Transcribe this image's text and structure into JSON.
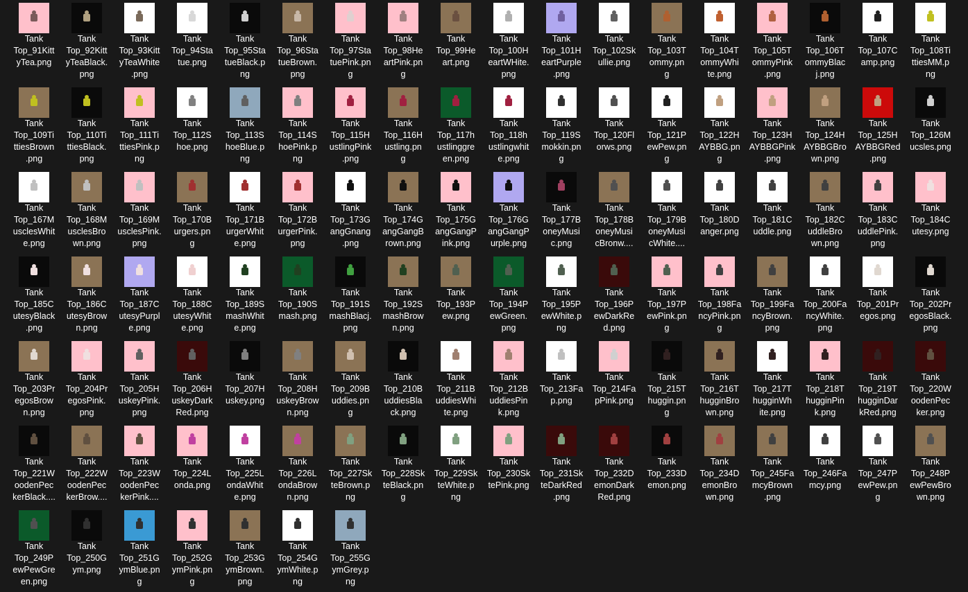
{
  "files": [
    {
      "name": "Tank\nTop_91Kitt\nyTea.png",
      "bg": "#ffc0cb",
      "fg": "#7a5a5a"
    },
    {
      "name": "Tank\nTop_92Kitt\nyTeaBlack.\npng",
      "bg": "#0a0a0a",
      "fg": "#b0a080"
    },
    {
      "name": "Tank\nTop_93Kitt\nyTeaWhite\n.png",
      "bg": "#ffffff",
      "fg": "#7a6a5a"
    },
    {
      "name": "Tank\nTop_94Sta\ntue.png",
      "bg": "#ffffff",
      "fg": "#d8d8d8"
    },
    {
      "name": "Tank\nTop_95Sta\ntueBlack.p\nng",
      "bg": "#0a0a0a",
      "fg": "#d0d0d0"
    },
    {
      "name": "Tank\nTop_96Sta\ntueBrown.\npng",
      "bg": "#8b7355",
      "fg": "#c8b8a8"
    },
    {
      "name": "Tank\nTop_97Sta\ntuePink.pn\ng",
      "bg": "#ffc0cb",
      "fg": "#e0d0d0"
    },
    {
      "name": "Tank\nTop_98He\nartPink.pn\ng",
      "bg": "#ffc0cb",
      "fg": "#a08080"
    },
    {
      "name": "Tank\nTop_99He\nart.png",
      "bg": "#8b7355",
      "fg": "#6a5040"
    },
    {
      "name": "Tank\nTop_100H\neartWHite.\npng",
      "bg": "#ffffff",
      "fg": "#b0b0b0"
    },
    {
      "name": "Tank\nTop_101H\neartPurple\n.png",
      "bg": "#b0a8f0",
      "fg": "#7060a0"
    },
    {
      "name": "Tank\nTop_102Sk\nullie.png",
      "bg": "#ffffff",
      "fg": "#606060"
    },
    {
      "name": "Tank\nTop_103T\nommy.pn\ng",
      "bg": "#8b7355",
      "fg": "#b06030"
    },
    {
      "name": "Tank\nTop_104T\nommyWhi\nte.png",
      "bg": "#ffffff",
      "fg": "#c06030"
    },
    {
      "name": "Tank\nTop_105T\nommyPink\n.png",
      "bg": "#ffc0cb",
      "fg": "#b06040"
    },
    {
      "name": "Tank\nTop_106T\nommyBlac\nj.png",
      "bg": "#0a0a0a",
      "fg": "#b06030"
    },
    {
      "name": "Tank\nTop_107C\namp.png",
      "bg": "#ffffff",
      "fg": "#202020"
    },
    {
      "name": "Tank\nTop_108Ti\nttiesMM.p\nng",
      "bg": "#ffffff",
      "fg": "#c0c020"
    },
    {
      "name": "Tank\nTop_109Ti\nttiesBrown\n.png",
      "bg": "#8b7355",
      "fg": "#c0c020"
    },
    {
      "name": "Tank\nTop_110Ti\nttiesBlack.\npng",
      "bg": "#0a0a0a",
      "fg": "#c0c020"
    },
    {
      "name": "Tank\nTop_111Ti\nttiesPink.p\nng",
      "bg": "#ffc0cb",
      "fg": "#c0c020"
    },
    {
      "name": "Tank\nTop_112S\nhoe.png",
      "bg": "#ffffff",
      "fg": "#808080"
    },
    {
      "name": "Tank\nTop_113S\nhoeBlue.p\nng",
      "bg": "#8fa8bc",
      "fg": "#606060"
    },
    {
      "name": "Tank\nTop_114S\nhoePink.p\nng",
      "bg": "#ffc0cb",
      "fg": "#808080"
    },
    {
      "name": "Tank\nTop_115H\nustlingPink\n.png",
      "bg": "#ffc0cb",
      "fg": "#a02040"
    },
    {
      "name": "Tank\nTop_116H\nustling.pn\ng",
      "bg": "#8b7355",
      "fg": "#a02040"
    },
    {
      "name": "Tank\nTop_117h\nustlinggre\nen.png",
      "bg": "#0b5a2a",
      "fg": "#a02040"
    },
    {
      "name": "Tank\nTop_118h\nustlingwhit\ne.png",
      "bg": "#ffffff",
      "fg": "#a02040"
    },
    {
      "name": "Tank\nTop_119S\nmokkin.pn\ng",
      "bg": "#ffffff",
      "fg": "#303030"
    },
    {
      "name": "Tank\nTop_120Fl\norws.png",
      "bg": "#ffffff",
      "fg": "#505050"
    },
    {
      "name": "Tank\nTop_121P\newPew.pn\ng",
      "bg": "#ffffff",
      "fg": "#202020"
    },
    {
      "name": "Tank\nTop_122H\nAYBBG.pn\ng",
      "bg": "#ffffff",
      "fg": "#c0a080"
    },
    {
      "name": "Tank\nTop_123H\nAYBBGPink\n.png",
      "bg": "#ffc0cb",
      "fg": "#c0a080"
    },
    {
      "name": "Tank\nTop_124H\nAYBBGBro\nwn.png",
      "bg": "#8b7355",
      "fg": "#c0a080"
    },
    {
      "name": "Tank\nTop_125H\nAYBBGRed\n.png",
      "bg": "#cc0a0a",
      "fg": "#c0a080"
    },
    {
      "name": "Tank\nTop_126M\nucsles.png",
      "bg": "#0a0a0a",
      "fg": "#d0d0d0"
    },
    {
      "name": "Tank\nTop_167M\nusclesWhit\ne.png",
      "bg": "#ffffff",
      "fg": "#c0c0c0"
    },
    {
      "name": "Tank\nTop_168M\nusclesBro\nwn.png",
      "bg": "#8b7355",
      "fg": "#c0c0c0"
    },
    {
      "name": "Tank\nTop_169M\nusclesPink.\npng",
      "bg": "#ffc0cb",
      "fg": "#c0c0c0"
    },
    {
      "name": "Tank\nTop_170B\nurgers.pn\ng",
      "bg": "#8b7355",
      "fg": "#a03030"
    },
    {
      "name": "Tank\nTop_171B\nurgerWhit\ne.png",
      "bg": "#ffffff",
      "fg": "#a03030"
    },
    {
      "name": "Tank\nTop_172B\nurgerPink.\npng",
      "bg": "#ffc0cb",
      "fg": "#a03030"
    },
    {
      "name": "Tank\nTop_173G\nangGnang\n.png",
      "bg": "#ffffff",
      "fg": "#101010"
    },
    {
      "name": "Tank\nTop_174G\nangGangB\nrown.png",
      "bg": "#8b7355",
      "fg": "#101010"
    },
    {
      "name": "Tank\nTop_175G\nangGangP\nink.png",
      "bg": "#ffc0cb",
      "fg": "#101010"
    },
    {
      "name": "Tank\nTop_176G\nangGangP\nurple.png",
      "bg": "#b0a8f0",
      "fg": "#101010"
    },
    {
      "name": "Tank\nTop_177B\noneyMusi\nc.png",
      "bg": "#0a0a0a",
      "fg": "#a04060"
    },
    {
      "name": "Tank\nTop_178B\noneyMusi\ncBronw....",
      "bg": "#8b7355",
      "fg": "#505050"
    },
    {
      "name": "Tank\nTop_179B\noneyMusi\ncWhite....",
      "bg": "#ffffff",
      "fg": "#505050"
    },
    {
      "name": "Tank\nTop_180D\nanger.png",
      "bg": "#ffffff",
      "fg": "#404040"
    },
    {
      "name": "Tank\nTop_181C\nuddle.png",
      "bg": "#ffffff",
      "fg": "#404040"
    },
    {
      "name": "Tank\nTop_182C\nuddleBro\nwn.png",
      "bg": "#8b7355",
      "fg": "#404040"
    },
    {
      "name": "Tank\nTop_183C\nuddlePink.\npng",
      "bg": "#ffc0cb",
      "fg": "#404040"
    },
    {
      "name": "Tank\nTop_184C\nutesy.png",
      "bg": "#ffc0cb",
      "fg": "#f0e0e0"
    },
    {
      "name": "Tank\nTop_185C\nutesyBlack\n.png",
      "bg": "#0a0a0a",
      "fg": "#f0e0e0"
    },
    {
      "name": "Tank\nTop_186C\nutesyBrow\nn.png",
      "bg": "#8b7355",
      "fg": "#f0e0e0"
    },
    {
      "name": "Tank\nTop_187C\nutesyPurpl\ne.png",
      "bg": "#b0a8f0",
      "fg": "#f0e0e0"
    },
    {
      "name": "Tank\nTop_188C\nutesyWhit\ne.png",
      "bg": "#ffffff",
      "fg": "#f0d0d0"
    },
    {
      "name": "Tank\nTop_189S\nmashWhit\ne.png",
      "bg": "#ffffff",
      "fg": "#204020"
    },
    {
      "name": "Tank\nTop_190S\nmash.png",
      "bg": "#0b5a2a",
      "fg": "#204020"
    },
    {
      "name": "Tank\nTop_191S\nmashBlacj.\npng",
      "bg": "#0a0a0a",
      "fg": "#40a040"
    },
    {
      "name": "Tank\nTop_192S\nmashBrow\nn.png",
      "bg": "#8b7355",
      "fg": "#204020"
    },
    {
      "name": "Tank\nTop_193P\new.png",
      "bg": "#8b7355",
      "fg": "#506050"
    },
    {
      "name": "Tank\nTop_194P\newGreen.\npng",
      "bg": "#0b5a2a",
      "fg": "#506050"
    },
    {
      "name": "Tank\nTop_195P\newWhite.p\nng",
      "bg": "#ffffff",
      "fg": "#506050"
    },
    {
      "name": "Tank\nTop_196P\newDarkRe\nd.png",
      "bg": "#3a0a0a",
      "fg": "#506050"
    },
    {
      "name": "Tank\nTop_197P\newPink.pn\ng",
      "bg": "#ffc0cb",
      "fg": "#506050"
    },
    {
      "name": "Tank\nTop_198Fa\nncyPink.pn\ng",
      "bg": "#ffc0cb",
      "fg": "#404040"
    },
    {
      "name": "Tank\nTop_199Fa\nncyBrown.\npng",
      "bg": "#8b7355",
      "fg": "#404040"
    },
    {
      "name": "Tank\nTop_200Fa\nncyWhite.\npng",
      "bg": "#ffffff",
      "fg": "#404040"
    },
    {
      "name": "Tank\nTop_201Pr\negos.png",
      "bg": "#ffffff",
      "fg": "#e0d8d0"
    },
    {
      "name": "Tank\nTop_202Pr\negosBlack.\npng",
      "bg": "#0a0a0a",
      "fg": "#e0d8d0"
    },
    {
      "name": "Tank\nTop_203Pr\negosBrow\nn.png",
      "bg": "#8b7355",
      "fg": "#e0d8d0"
    },
    {
      "name": "Tank\nTop_204Pr\negosPink.\npng",
      "bg": "#ffc0cb",
      "fg": "#f0e0e0"
    },
    {
      "name": "Tank\nTop_205H\nuskeyPink.\npng",
      "bg": "#ffc0cb",
      "fg": "#606060"
    },
    {
      "name": "Tank\nTop_206H\nuskeyDark\nRed.png",
      "bg": "#3a0a0a",
      "fg": "#606060"
    },
    {
      "name": "Tank\nTop_207H\nuskey.png",
      "bg": "#0a0a0a",
      "fg": "#808080"
    },
    {
      "name": "Tank\nTop_208H\nuskeyBrow\nn.png",
      "bg": "#8b7355",
      "fg": "#808080"
    },
    {
      "name": "Tank\nTop_209B\nuddies.pn\ng",
      "bg": "#8b7355",
      "fg": "#d0c0b0"
    },
    {
      "name": "Tank\nTop_210B\nuddiesBla\nck.png",
      "bg": "#0a0a0a",
      "fg": "#d0c0b0"
    },
    {
      "name": "Tank\nTop_211B\nuddiesWhi\nte.png",
      "bg": "#ffffff",
      "fg": "#a08070"
    },
    {
      "name": "Tank\nTop_212B\nuddiesPin\nk.png",
      "bg": "#ffc0cb",
      "fg": "#a08070"
    },
    {
      "name": "Tank\nTop_213Fa\np.png",
      "bg": "#ffffff",
      "fg": "#c0c0c0"
    },
    {
      "name": "Tank\nTop_214Fa\npPink.png",
      "bg": "#ffc0cb",
      "fg": "#d0d0d0"
    },
    {
      "name": "Tank\nTop_215T\nhuggin.pn\ng",
      "bg": "#0a0a0a",
      "fg": "#302020"
    },
    {
      "name": "Tank\nTop_216T\nhugginBro\nwn.png",
      "bg": "#8b7355",
      "fg": "#302020"
    },
    {
      "name": "Tank\nTop_217T\nhugginWh\nite.png",
      "bg": "#ffffff",
      "fg": "#302020"
    },
    {
      "name": "Tank\nTop_218T\nhugginPin\nk.png",
      "bg": "#ffc0cb",
      "fg": "#302020"
    },
    {
      "name": "Tank\nTop_219T\nhugginDar\nkRed.png",
      "bg": "#3a0a0a",
      "fg": "#302020"
    },
    {
      "name": "Tank\nTop_220W\noodenPec\nker.png",
      "bg": "#3a0a0a",
      "fg": "#605040"
    },
    {
      "name": "Tank\nTop_221W\noodenPec\nkerBlack....",
      "bg": "#0a0a0a",
      "fg": "#605040"
    },
    {
      "name": "Tank\nTop_222W\noodenPec\nkerBrow....",
      "bg": "#8b7355",
      "fg": "#605040"
    },
    {
      "name": "Tank\nTop_223W\noodenPec\nkerPink....",
      "bg": "#ffc0cb",
      "fg": "#605040"
    },
    {
      "name": "Tank\nTop_224L\nonda.png",
      "bg": "#ffc0cb",
      "fg": "#c040a0"
    },
    {
      "name": "Tank\nTop_225L\nondaWhit\ne.png",
      "bg": "#ffffff",
      "fg": "#c040a0"
    },
    {
      "name": "Tank\nTop_226L\nondaBrow\nn.png",
      "bg": "#8b7355",
      "fg": "#c040a0"
    },
    {
      "name": "Tank\nTop_227Sk\nteBrown.p\nng",
      "bg": "#8b7355",
      "fg": "#80a080"
    },
    {
      "name": "Tank\nTop_228Sk\nteBlack.pn\ng",
      "bg": "#0a0a0a",
      "fg": "#80a080"
    },
    {
      "name": "Tank\nTop_229Sk\nteWhite.p\nng",
      "bg": "#ffffff",
      "fg": "#80a080"
    },
    {
      "name": "Tank\nTop_230Sk\ntePink.png",
      "bg": "#ffc0cb",
      "fg": "#80a080"
    },
    {
      "name": "Tank\nTop_231Sk\nteDarkRed\n.png",
      "bg": "#3a0a0a",
      "fg": "#80a080"
    },
    {
      "name": "Tank\nTop_232D\nemonDark\nRed.png",
      "bg": "#3a0a0a",
      "fg": "#a04040"
    },
    {
      "name": "Tank\nTop_233D\nemon.png",
      "bg": "#0a0a0a",
      "fg": "#a04040"
    },
    {
      "name": "Tank\nTop_234D\nemonBro\nwn.png",
      "bg": "#8b7355",
      "fg": "#a04040"
    },
    {
      "name": "Tank\nTop_245Fa\nmcyBrown\n.png",
      "bg": "#8b7355",
      "fg": "#404040"
    },
    {
      "name": "Tank\nTop_246Fa\nmcy.png",
      "bg": "#ffffff",
      "fg": "#404040"
    },
    {
      "name": "Tank\nTop_247P\newPew.pn\ng",
      "bg": "#ffffff",
      "fg": "#505050"
    },
    {
      "name": "Tank\nTop_248P\newPewBro\nwn.png",
      "bg": "#8b7355",
      "fg": "#505050"
    },
    {
      "name": "Tank\nTop_249P\newPewGre\nen.png",
      "bg": "#0b5a2a",
      "fg": "#505050"
    },
    {
      "name": "Tank\nTop_250G\nym.png",
      "bg": "#0a0a0a",
      "fg": "#303030"
    },
    {
      "name": "Tank\nTop_251G\nymBlue.pn\ng",
      "bg": "#3a9ad4",
      "fg": "#303030"
    },
    {
      "name": "Tank\nTop_252G\nymPink.pn\ng",
      "bg": "#ffc0cb",
      "fg": "#303030"
    },
    {
      "name": "Tank\nTop_253G\nymBrown.\npng",
      "bg": "#8b7355",
      "fg": "#303030"
    },
    {
      "name": "Tank\nTop_254G\nymWhite.p\nng",
      "bg": "#ffffff",
      "fg": "#303030"
    },
    {
      "name": "Tank\nTop_255G\nymGrey.p\nng",
      "bg": "#8fa8bc",
      "fg": "#303030"
    }
  ]
}
